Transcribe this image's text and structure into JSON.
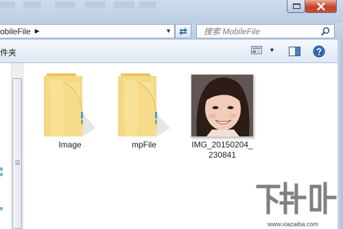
{
  "addressbar": {
    "breadcrumb": "obileFile",
    "separator": "▶",
    "dropdown": "▼"
  },
  "search": {
    "placeholder": "搜索 MobileFile"
  },
  "toolbar": {
    "label": "件夹",
    "views_arrow": "▼"
  },
  "files": [
    {
      "name": "Image",
      "type": "folder"
    },
    {
      "name": "mpFile",
      "type": "folder"
    },
    {
      "name_line1": "IMG_20150204_",
      "name_line2": "230841",
      "type": "image"
    }
  ],
  "watermark": {
    "text": "下载吧",
    "url": "www.xiazaiba.com"
  },
  "colors": {
    "titlebar": "#c4d4e8",
    "close_button": "#c5432a",
    "folder": "#f2d27a",
    "help_blue": "#1f5fae"
  }
}
